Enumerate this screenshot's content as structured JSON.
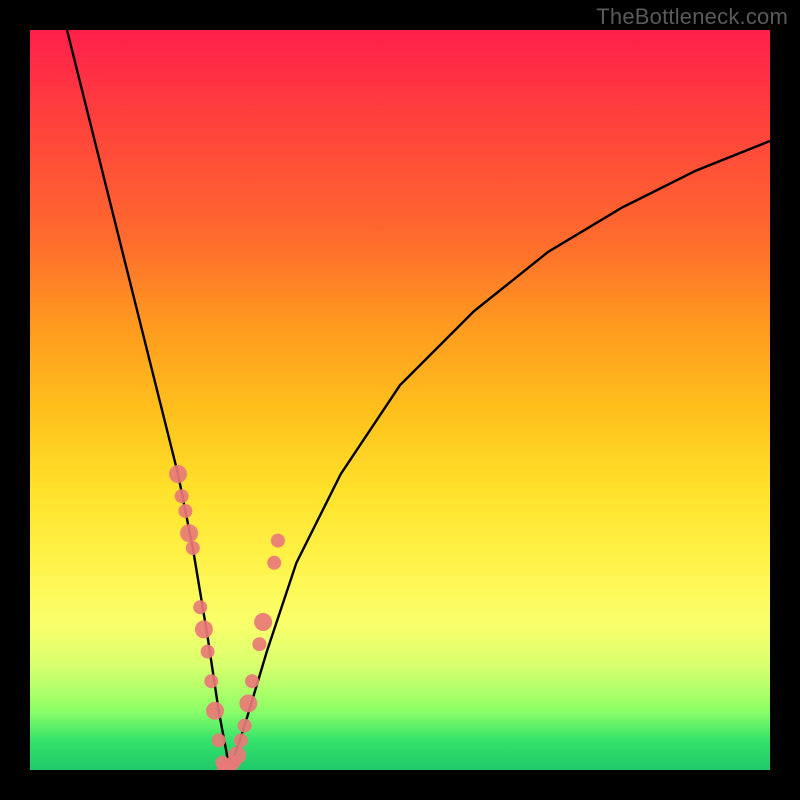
{
  "watermark": "TheBottleneck.com",
  "chart_data": {
    "type": "line",
    "title": "",
    "xlabel": "",
    "ylabel": "",
    "xlim": [
      0,
      100
    ],
    "ylim": [
      0,
      100
    ],
    "grid": false,
    "legend": false,
    "background_gradient": {
      "direction": "vertical",
      "stops": [
        {
          "pos": 0,
          "color": "#ff1f4a"
        },
        {
          "pos": 50,
          "color": "#ffc21c"
        },
        {
          "pos": 80,
          "color": "#faff6a"
        },
        {
          "pos": 100,
          "color": "#1fc96a"
        }
      ]
    },
    "series": [
      {
        "name": "bottleneck-curve",
        "color": "#000000",
        "x": [
          5,
          8,
          11,
          14,
          17,
          20,
          22,
          24,
          25.5,
          27,
          29,
          32,
          36,
          42,
          50,
          60,
          70,
          80,
          90,
          100
        ],
        "y": [
          100,
          88,
          76,
          64,
          52,
          40,
          30,
          18,
          8,
          0,
          6,
          16,
          28,
          40,
          52,
          62,
          70,
          76,
          81,
          85
        ]
      }
    ],
    "points": {
      "name": "salmon-dots",
      "color": "#e87a78",
      "x": [
        20,
        20.5,
        21,
        21.5,
        22,
        23,
        23.5,
        24,
        24.5,
        25,
        25.5,
        26,
        26.5,
        27,
        27.5,
        28,
        28.5,
        29,
        29.5,
        30,
        31,
        31.5,
        33,
        33.5
      ],
      "y": [
        40,
        37,
        35,
        32,
        30,
        22,
        19,
        16,
        12,
        8,
        4,
        1,
        0,
        0,
        1,
        2,
        4,
        6,
        9,
        12,
        17,
        20,
        28,
        31
      ]
    }
  }
}
